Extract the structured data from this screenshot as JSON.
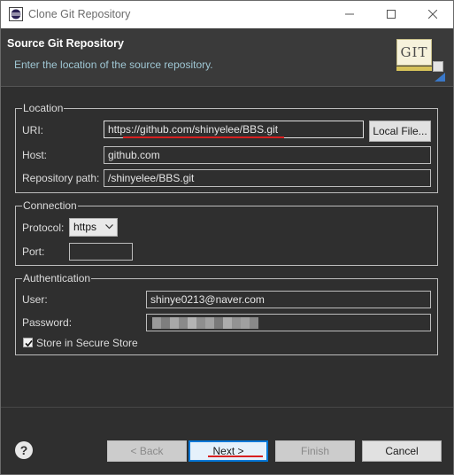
{
  "window": {
    "title": "Clone Git Repository",
    "icons": {
      "app": "eclipse-icon",
      "minimize": "minimize-icon",
      "maximize": "maximize-icon",
      "close": "close-icon"
    }
  },
  "banner": {
    "title": "Source Git Repository",
    "description": "Enter the location of the source repository.",
    "logo_text": "GIT"
  },
  "location": {
    "label": "Location",
    "uri_label": "URI:",
    "uri_value": "https://github.com/shinyelee/BBS.git",
    "local_file_button": "Local File...",
    "host_label": "Host:",
    "host_value": "github.com",
    "repo_path_label": "Repository path:",
    "repo_path_value": "/shinyelee/BBS.git"
  },
  "connection": {
    "label": "Connection",
    "protocol_label": "Protocol:",
    "protocol_value": "https",
    "port_label": "Port:",
    "port_value": ""
  },
  "authentication": {
    "label": "Authentication",
    "user_label": "User:",
    "user_value": "shinye0213@naver.com",
    "password_label": "Password:",
    "store_label": "Store in Secure Store",
    "store_checked": true
  },
  "footer": {
    "help": "?",
    "back": "< Back",
    "next": "Next >",
    "finish": "Finish",
    "cancel": "Cancel"
  },
  "colors": {
    "accent": "#0078d7",
    "annotation_red": "#d82020",
    "banner_desc": "#9fc7d4",
    "background": "#2f2f2f"
  }
}
